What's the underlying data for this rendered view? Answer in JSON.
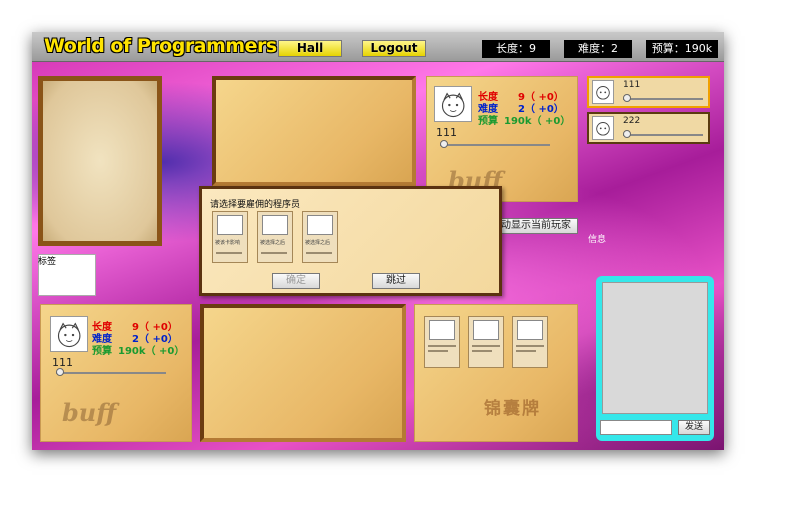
{
  "app": {
    "title": "World of Programmers"
  },
  "nav": {
    "hall_label": "Hall",
    "logout_label": "Logout"
  },
  "stats": {
    "length": "长度：9",
    "difficulty": "难度：2",
    "budget": "预算：190k"
  },
  "players": [
    {
      "name": "111",
      "slider": 0.0,
      "highlight": true
    },
    {
      "name": "222",
      "slider": 0.0,
      "highlight": false
    }
  ],
  "project_top": {
    "length_label": "长度",
    "length_value": "9（ +0）",
    "difficulty_label": "难度",
    "difficulty_value": "2（ +0）",
    "budget_label": "预算",
    "budget_value": "190k（ +0）",
    "name": "111",
    "buff": "buff"
  },
  "project_bottom": {
    "length_label": "长度",
    "length_value": "9（ +0）",
    "difficulty_label": "难度",
    "difficulty_value": "2（ +0）",
    "budget_label": "预算",
    "budget_value": "190k（ +0）",
    "name": "111",
    "buff": "buff"
  },
  "auto_show_button": "自动显示当前玩家",
  "info_label": "信息",
  "note_label": "标签",
  "brocade_label": "锦囊牌",
  "modal": {
    "title": "请选择要雇佣的程序员",
    "confirm_label": "确定",
    "skip_label": "跳过",
    "cards": [
      {
        "text": "被该卡影响"
      },
      {
        "text": "被选择之后"
      },
      {
        "text": "被选择之后"
      }
    ]
  },
  "chat": {
    "input_value": "",
    "send_label": "发送"
  },
  "colors": {
    "length": "#e00000",
    "difficulty": "#0022cc",
    "budget": "#1a9a30",
    "accent": "#ffe400"
  }
}
